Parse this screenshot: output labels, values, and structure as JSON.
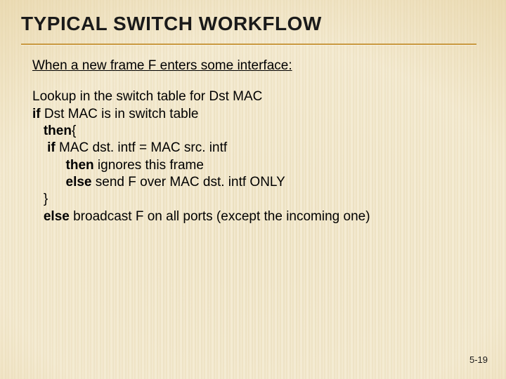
{
  "title": "TYPICAL SWITCH WORKFLOW",
  "intro": "When a new frame F enters some interface:",
  "algo": {
    "l1": "Lookup in the switch table for Dst MAC",
    "l2": {
      "kw": "if",
      "rest": " Dst MAC is in switch table"
    },
    "l3": {
      "kw": "then",
      "rest": "{"
    },
    "l4": {
      "pre": "    ",
      "kw": "if",
      "rest": " MAC dst. intf = MAC src. intf"
    },
    "l5": {
      "pre": "         ",
      "kw": "then",
      "rest": " ignores this frame"
    },
    "l6": {
      "pre": "         ",
      "kw": "else",
      "rest": " send F over MAC dst. intf ONLY"
    },
    "l7": "   }",
    "l8": {
      "pre": "   ",
      "kw": "else",
      "rest": " broadcast F on all ports (except the incoming one)"
    }
  },
  "page_number": "5-19"
}
